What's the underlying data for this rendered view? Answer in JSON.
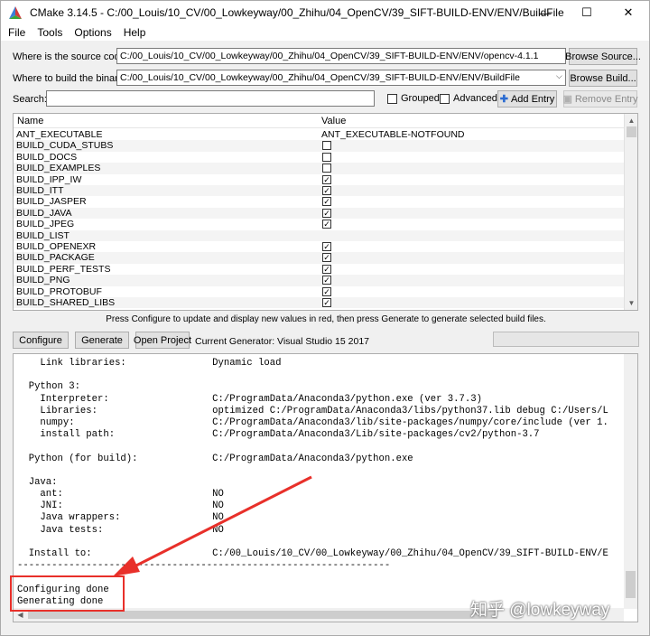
{
  "window": {
    "title": "CMake 3.14.5 - C:/00_Louis/10_CV/00_Lowkeyway/00_Zhihu/04_OpenCV/39_SIFT-BUILD-ENV/ENV/BuildFile",
    "minimize": "—",
    "maximize": "☐",
    "close": "✕"
  },
  "menu": [
    "File",
    "Tools",
    "Options",
    "Help"
  ],
  "source": {
    "label": "Where is the source code:",
    "value": "C:/00_Louis/10_CV/00_Lowkeyway/00_Zhihu/04_OpenCV/39_SIFT-BUILD-ENV/ENV/opencv-4.1.1",
    "button": "Browse Source..."
  },
  "build": {
    "label": "Where to build the binaries:",
    "value": "C:/00_Louis/10_CV/00_Lowkeyway/00_Zhihu/04_OpenCV/39_SIFT-BUILD-ENV/ENV/BuildFile",
    "button": "Browse Build..."
  },
  "search": {
    "label": "Search:",
    "value": "",
    "grouped": "Grouped",
    "advanced": "Advanced",
    "add_entry": "Add Entry",
    "remove_entry": "Remove Entry"
  },
  "table": {
    "col_name": "Name",
    "col_value": "Value",
    "rows": [
      {
        "name": "ANT_EXECUTABLE",
        "value": "ANT_EXECUTABLE-NOTFOUND"
      },
      {
        "name": "BUILD_CUDA_STUBS",
        "checked": false
      },
      {
        "name": "BUILD_DOCS",
        "checked": false
      },
      {
        "name": "BUILD_EXAMPLES",
        "checked": false
      },
      {
        "name": "BUILD_IPP_IW",
        "checked": true
      },
      {
        "name": "BUILD_ITT",
        "checked": true
      },
      {
        "name": "BUILD_JASPER",
        "checked": true
      },
      {
        "name": "BUILD_JAVA",
        "checked": true
      },
      {
        "name": "BUILD_JPEG",
        "checked": true
      },
      {
        "name": "BUILD_LIST",
        "value": ""
      },
      {
        "name": "BUILD_OPENEXR",
        "checked": true
      },
      {
        "name": "BUILD_PACKAGE",
        "checked": true
      },
      {
        "name": "BUILD_PERF_TESTS",
        "checked": true
      },
      {
        "name": "BUILD_PNG",
        "checked": true
      },
      {
        "name": "BUILD_PROTOBUF",
        "checked": true
      },
      {
        "name": "BUILD_SHARED_LIBS",
        "checked": true
      }
    ]
  },
  "hint": "Press Configure to update and display new values in red, then press Generate to generate selected build files.",
  "actions": {
    "configure": "Configure",
    "generate": "Generate",
    "open_project": "Open Project",
    "current_generator": "Current Generator: Visual Studio 15 2017"
  },
  "log": [
    "    Link libraries:               Dynamic load",
    "",
    "  Python 3:",
    "    Interpreter:                  C:/ProgramData/Anaconda3/python.exe (ver 3.7.3)",
    "    Libraries:                    optimized C:/ProgramData/Anaconda3/libs/python37.lib debug C:/Users/L",
    "    numpy:                        C:/ProgramData/Anaconda3/lib/site-packages/numpy/core/include (ver 1.",
    "    install path:                 C:/ProgramData/Anaconda3/Lib/site-packages/cv2/python-3.7",
    "",
    "  Python (for build):             C:/ProgramData/Anaconda3/python.exe",
    "",
    "  Java:",
    "    ant:                          NO",
    "    JNI:                          NO",
    "    Java wrappers:                NO",
    "    Java tests:                   NO",
    "",
    "  Install to:                     C:/00_Louis/10_CV/00_Lowkeyway/00_Zhihu/04_OpenCV/39_SIFT-BUILD-ENV/E",
    "-----------------------------------------------------------------",
    "",
    "Configuring done",
    "Generating done"
  ],
  "watermark": "知乎 @lowkeyway",
  "colors": {
    "annotation_red": "#e8302a"
  }
}
